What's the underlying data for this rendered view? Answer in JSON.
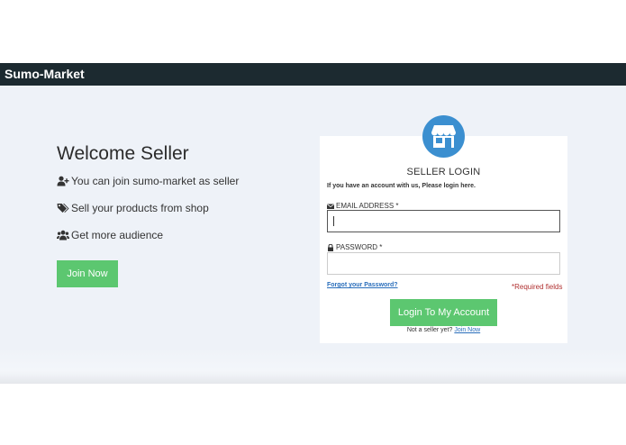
{
  "app": {
    "brand": "Sumo-Market"
  },
  "welcome": {
    "title": "Welcome Seller",
    "features": [
      {
        "icon": "user-plus-icon",
        "text": "You can join sumo-market as seller"
      },
      {
        "icon": "tags-icon",
        "text": "Sell your products from shop"
      },
      {
        "icon": "users-icon",
        "text": "Get more audience"
      }
    ],
    "join_button": "Join Now"
  },
  "login": {
    "badge_icon": "store-icon",
    "title": "SELLER LOGIN",
    "subtitle": "If you have an account with us, Please login here.",
    "email_label": "EMAIL ADDRESS *",
    "email_value": "",
    "password_label": "PASSWORD *",
    "password_value": "",
    "forgot_link": "Forgot your Password?",
    "required_note": "*Required fields",
    "submit_button": "Login To My Account",
    "not_seller_text": "Not a seller yet?",
    "join_link": "Join Now"
  },
  "colors": {
    "navbar": "#1c2a30",
    "accent_green": "#5cc770",
    "badge_blue": "#3b8fd0",
    "link_blue": "#2a6ebb",
    "required_red": "#b03030"
  }
}
